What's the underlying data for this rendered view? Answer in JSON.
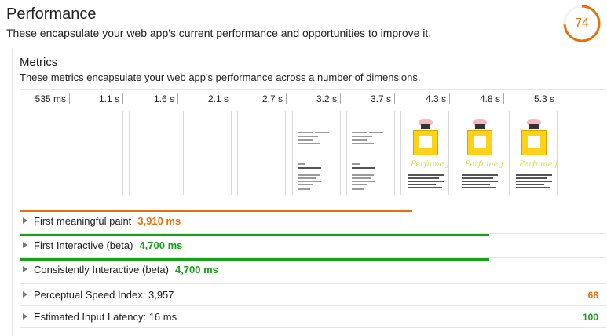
{
  "header": {
    "title": "Performance",
    "description": "These encapsulate your web app's current performance and opportunities to improve it.",
    "score": 74,
    "score_color": "#e8700a"
  },
  "metrics": {
    "title": "Metrics",
    "description": "These metrics encapsulate your web app's performance across a number of dimensions."
  },
  "timeline": {
    "times": [
      "535 ms",
      "1.1 s",
      "1.6 s",
      "2.1 s",
      "2.7 s",
      "3.2 s",
      "3.7 s",
      "4.3 s",
      "4.8 s",
      "5.3 s"
    ],
    "frames": [
      "blank",
      "blank",
      "blank",
      "blank",
      "blank",
      "text",
      "text",
      "bottle",
      "bottle",
      "bottle"
    ],
    "bottle_caption": "Perfume.js"
  },
  "metric_rows": [
    {
      "label": "First meaningful paint",
      "value": "3,910 ms",
      "color": "#e8700a"
    },
    {
      "label": "First Interactive (beta)",
      "value": "4,700 ms",
      "color": "#18a01a"
    },
    {
      "label": "Consistently Interactive (beta)",
      "value": "4,700 ms",
      "color": "#18a01a"
    },
    {
      "label": "Perceptual Speed Index: 3,957",
      "score": "68",
      "score_color": "#e8700a"
    },
    {
      "label": "Estimated Input Latency: 16 ms",
      "score": "100",
      "score_color": "#18a01a"
    }
  ],
  "bar_progress": [
    0.67,
    0.8,
    0.8
  ],
  "bar_colors": [
    "#e8700a",
    "#18a01a",
    "#18a01a"
  ]
}
